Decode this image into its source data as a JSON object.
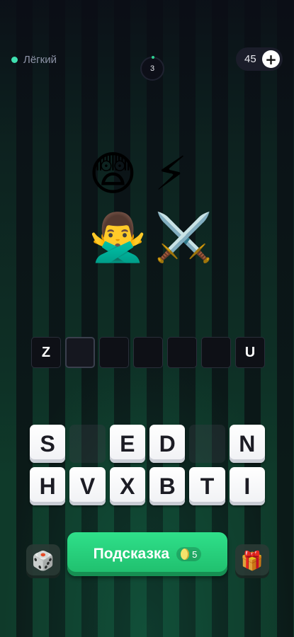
{
  "topbar": {
    "difficulty": "Лёгкий",
    "level": "3",
    "coins": "45",
    "add_coins_icon": "plus-icon"
  },
  "puzzle": {
    "emojis": [
      "😨",
      "⚡",
      "🙅‍♂️",
      "⚔️"
    ]
  },
  "answer": {
    "slots": [
      "Z",
      "",
      "",
      "",
      "",
      "",
      "U"
    ]
  },
  "letters": {
    "row1": [
      "S",
      "",
      "E",
      "D",
      "",
      "N"
    ],
    "row2": [
      "H",
      "V",
      "X",
      "B",
      "T",
      "I"
    ]
  },
  "controls": {
    "shuffle_icon": "dice-icon",
    "hint_label": "Подсказка",
    "hint_cost": "5",
    "extra_icon": "gift-icon"
  },
  "colors": {
    "accent_green": "#2fe08a",
    "difficulty_dot": "#3fe0b0"
  }
}
